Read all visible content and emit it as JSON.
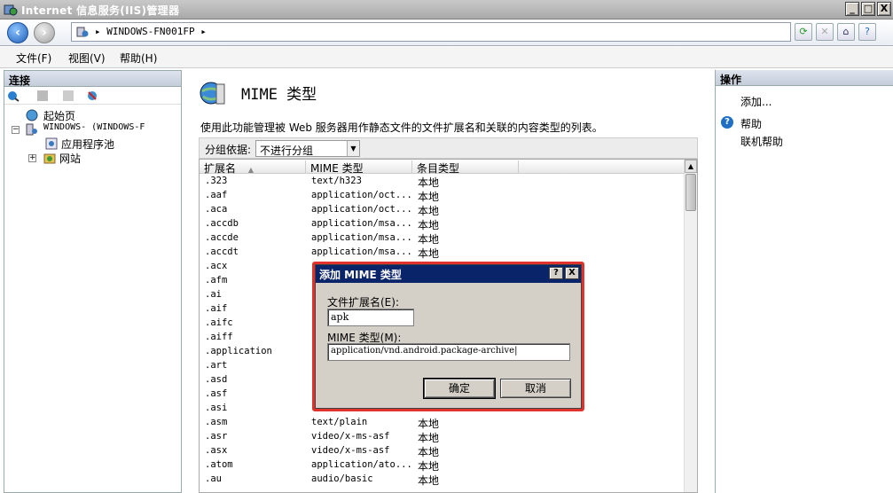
{
  "window": {
    "title": "Internet 信息服务(IIS)管理器",
    "min": "_",
    "max": "□",
    "close": "X"
  },
  "address": {
    "crumb": "▸ WINDOWS-FN001FP ▸"
  },
  "menu": {
    "file": "文件(F)",
    "view": "视图(V)",
    "help": "帮助(H)"
  },
  "connections": {
    "header": "连接",
    "tree": [
      {
        "label": "起始页"
      },
      {
        "label": "WINDOWS-           (WINDOWS-F"
      },
      {
        "label": "应用程序池"
      },
      {
        "label": "网站"
      }
    ]
  },
  "feature": {
    "title": "MIME 类型",
    "description": "使用此功能管理被 Web 服务器用作静态文件的文件扩展名和关联的内容类型的列表。",
    "group_label": "分组依据:",
    "group_value": "不进行分组",
    "columns": [
      "扩展名",
      "MIME 类型",
      "条目类型"
    ],
    "rows": [
      [
        ".323",
        "text/h323",
        "本地"
      ],
      [
        ".aaf",
        "application/oct...",
        "本地"
      ],
      [
        ".aca",
        "application/oct...",
        "本地"
      ],
      [
        ".accdb",
        "application/msa...",
        "本地"
      ],
      [
        ".accde",
        "application/msa...",
        "本地"
      ],
      [
        ".accdt",
        "application/msa...",
        "本地"
      ],
      [
        ".acx",
        "",
        ""
      ],
      [
        ".afm",
        "",
        ""
      ],
      [
        ".ai",
        "",
        ""
      ],
      [
        ".aif",
        "",
        ""
      ],
      [
        ".aifc",
        "",
        ""
      ],
      [
        ".aiff",
        "",
        ""
      ],
      [
        ".application",
        "",
        ""
      ],
      [
        ".art",
        "",
        ""
      ],
      [
        ".asd",
        "",
        ""
      ],
      [
        ".asf",
        "",
        ""
      ],
      [
        ".asi",
        "",
        ""
      ],
      [
        ".asm",
        "text/plain",
        "本地"
      ],
      [
        ".asr",
        "video/x-ms-asf",
        "本地"
      ],
      [
        ".asx",
        "video/x-ms-asf",
        "本地"
      ],
      [
        ".atom",
        "application/ato...",
        "本地"
      ],
      [
        ".au",
        "audio/basic",
        "本地"
      ]
    ]
  },
  "actions": {
    "header": "操作",
    "add": "添加...",
    "help": "帮助",
    "online_help": "联机帮助"
  },
  "dialog": {
    "title": "添加 MIME 类型",
    "help_btn": "?",
    "close_btn": "X",
    "ext_label": "文件扩展名(E):",
    "ext_value": "apk",
    "mime_label": "MIME 类型(M):",
    "mime_value": "application/vnd.android.package-archive",
    "ok": "确定",
    "cancel": "取消"
  }
}
